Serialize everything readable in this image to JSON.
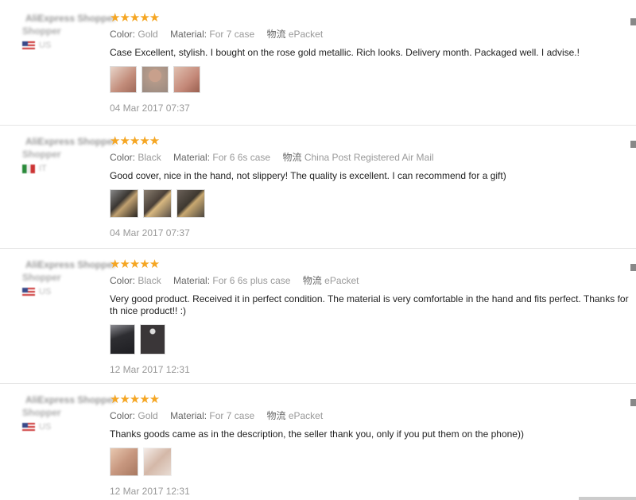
{
  "reviews": [
    {
      "user": {
        "name": "AliExpress Shopper",
        "line2": "Shopper",
        "country": "US",
        "flag": "us"
      },
      "stars": "★★★★★",
      "color_key": "Color:",
      "color_val": "Gold",
      "material_key": "Material:",
      "material_val": "For 7 case",
      "ship_key": "物流",
      "ship_val": "ePacket",
      "text": "Case Excellent, stylish. I bought on the rose gold metallic. Rich looks. Delivery month. Packaged well. I advise.!",
      "date": "04 Mar 2017 07:37",
      "thumbs": [
        "#c28c7a",
        "#b49a8a",
        "#c48878"
      ]
    },
    {
      "user": {
        "name": "AliExpress Shopper",
        "line2": "Shopper",
        "country": "IT",
        "flag": "it"
      },
      "stars": "★★★★★",
      "color_key": "Color:",
      "color_val": "Black",
      "material_key": "Material:",
      "material_val": "For 6 6s case",
      "ship_key": "物流",
      "ship_val": "China Post Registered Air Mail",
      "text": "Good cover, nice in the hand, not slippery! The quality is excellent. I can recommend for a gift)",
      "date": "04 Mar 2017 07:37",
      "thumbs": [
        "#3a3632",
        "#6a5e50",
        "#4e4840"
      ]
    },
    {
      "user": {
        "name": "AliExpress Shopper",
        "line2": "Shopper",
        "country": "US",
        "flag": "us"
      },
      "stars": "★★★★★",
      "color_key": "Color:",
      "color_val": "Black",
      "material_key": "Material:",
      "material_val": "For 6 6s plus case",
      "ship_key": "物流",
      "ship_val": "ePacket",
      "text": "Very good product. Received it in perfect condition. The material is very comfortable in the hand and fits perfect. Thanks for th nice product!! :)",
      "date": "12 Mar 2017 12:31",
      "thumbs": [
        "#2e2e32",
        "#3a3638"
      ]
    },
    {
      "user": {
        "name": "AliExpress Shopper",
        "line2": "Shopper",
        "country": "US",
        "flag": "us"
      },
      "stars": "★★★★★",
      "color_key": "Color:",
      "color_val": "Gold",
      "material_key": "Material:",
      "material_val": "For 7 case",
      "ship_key": "物流",
      "ship_val": "ePacket",
      "text": "Thanks goods came as in the description, the seller thank you, only if you put them on the phone))",
      "date": "12 Mar 2017 12:31",
      "thumbs": [
        "#c89880",
        "#d4b8a8"
      ]
    }
  ],
  "colors": {
    "stars": "#f5a623",
    "badge": "#e64a2e",
    "divider": "#e6e6e6"
  }
}
